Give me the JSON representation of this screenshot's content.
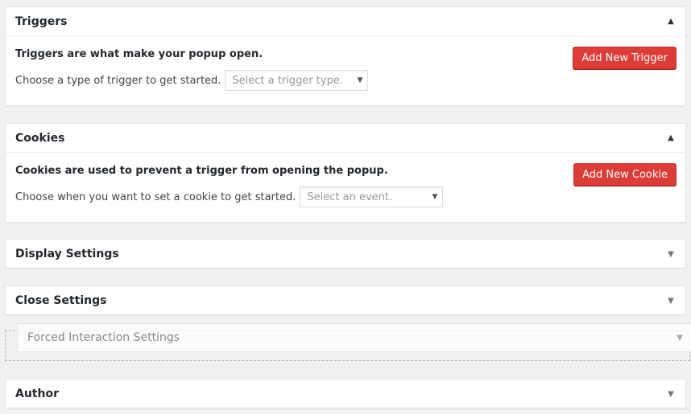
{
  "triggers": {
    "title": "Triggers",
    "description": "Triggers are what make your popup open.",
    "choose_label": "Choose a type of trigger to get started.",
    "select_placeholder": "Select a trigger type.",
    "add_button": "Add New Trigger"
  },
  "cookies": {
    "title": "Cookies",
    "description": "Cookies are used to prevent a trigger from opening the popup.",
    "choose_label": "Choose when you want to set a cookie to get started.",
    "select_placeholder": "Select an event.",
    "add_button": "Add New Cookie"
  },
  "display_settings": {
    "title": "Display Settings"
  },
  "close_settings": {
    "title": "Close Settings"
  },
  "forced_interaction": {
    "title": "Forced Interaction Settings"
  },
  "author": {
    "title": "Author"
  },
  "icons": {
    "expanded": "arrow-up-icon",
    "collapsed": "arrow-down-icon",
    "dropdown": "caret-down-icon"
  },
  "colors": {
    "button_red": "#dd3d36",
    "background": "#f1f1f1"
  }
}
